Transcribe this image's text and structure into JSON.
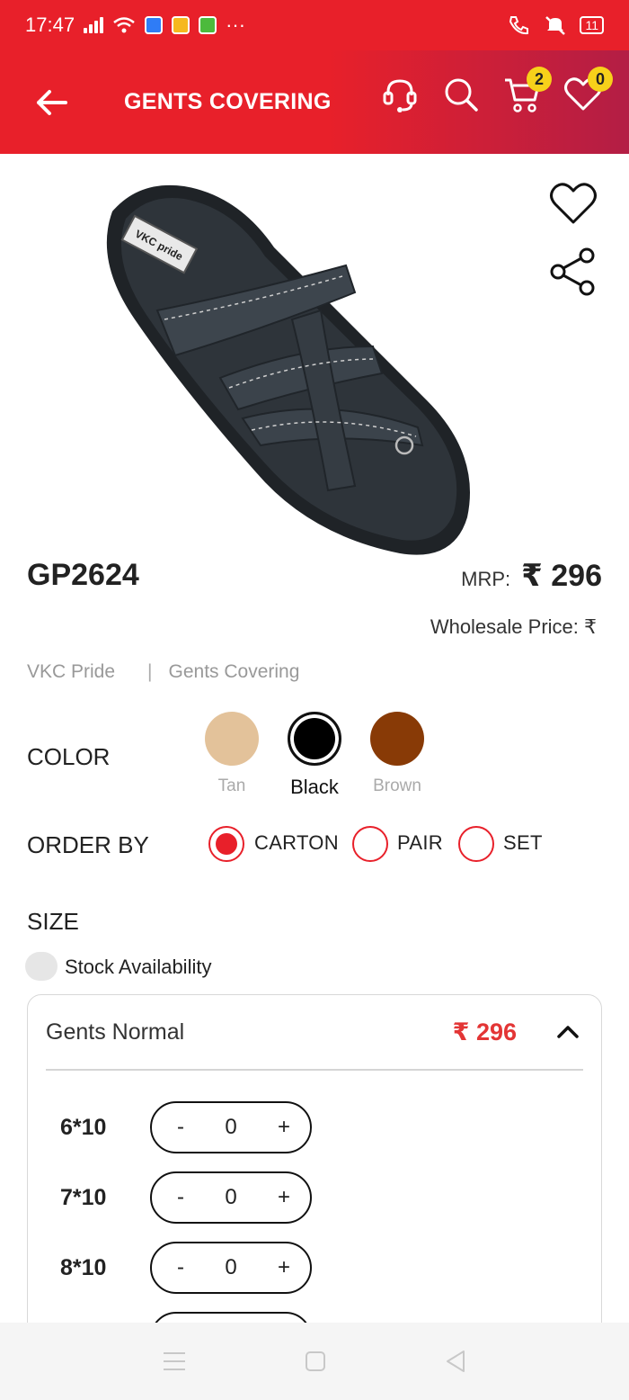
{
  "status_bar": {
    "time": "17:47",
    "battery": "11",
    "more": "···"
  },
  "header": {
    "title": "GENTS COVERING",
    "cart_count": "2",
    "wishlist_count": "0"
  },
  "product": {
    "code": "GP2624",
    "mrp_label": "MRP:",
    "mrp_value": "₹ 296",
    "wholesale_label": "Wholesale Price:  ₹",
    "brand": "VKC Pride",
    "separator": "|",
    "category": "Gents Covering",
    "image_logo_text": "VKC pride"
  },
  "color": {
    "label": "COLOR",
    "options": [
      {
        "name": "Tan",
        "hex": "#e3c29a"
      },
      {
        "name": "Black",
        "hex": "#000000"
      },
      {
        "name": "Brown",
        "hex": "#883a06"
      }
    ],
    "selected": "Black"
  },
  "order_by": {
    "label": "ORDER BY",
    "options": [
      "CARTON",
      "PAIR",
      "SET"
    ],
    "selected": "CARTON"
  },
  "size": {
    "label": "SIZE",
    "stock_toggle_label": "Stock Availability",
    "group": {
      "name": "Gents Normal",
      "price": "₹ 296",
      "rows": [
        {
          "size": "6*10",
          "qty": "0"
        },
        {
          "size": "7*10",
          "qty": "0"
        },
        {
          "size": "8*10",
          "qty": "0"
        }
      ],
      "minus": "-",
      "plus": "+"
    }
  },
  "colors": {
    "brand_red": "#e8202a",
    "header_gradient_end": "#b31e45",
    "badge_yellow": "#f7d11a",
    "price_red": "#e33535"
  }
}
